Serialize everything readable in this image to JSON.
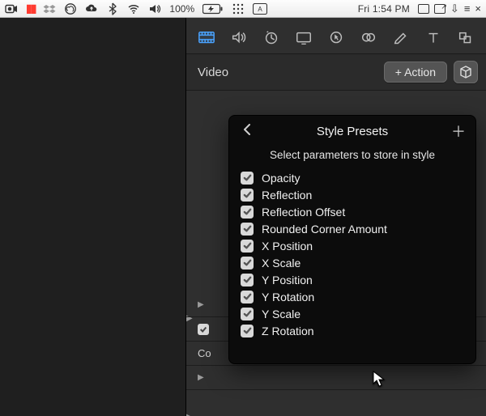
{
  "menubar": {
    "battery_text": "100%",
    "clock": "Fri 1:54 PM"
  },
  "inspector": {
    "section_title": "Video",
    "action_button": "+ Action",
    "bg_row2_label": "Co"
  },
  "popover": {
    "title": "Style Presets",
    "subtitle": "Select parameters to store in style",
    "params": [
      "Opacity",
      "Reflection",
      "Reflection Offset",
      "Rounded Corner Amount",
      "X Position",
      "X Scale",
      "Y Position",
      "Y Rotation",
      "Y Scale",
      "Z Rotation"
    ]
  }
}
